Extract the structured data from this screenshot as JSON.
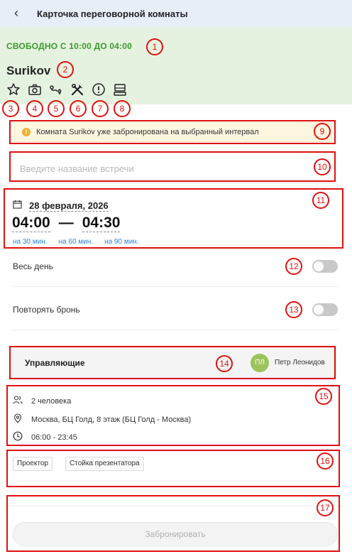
{
  "header": {
    "back_icon": "chevron-left-icon",
    "title": "Карточка переговорной комнаты"
  },
  "room": {
    "status": "СВОБОДНО С 10:00 ДО 04:00",
    "status_color": "#3a9b2a",
    "name": "Surikov",
    "icons": [
      "star-icon",
      "camera-icon",
      "route-icon",
      "tools-icon",
      "alert-icon",
      "workstation-icon"
    ]
  },
  "warning": {
    "text": "Комната Surikov уже забронирована на выбранный интервал"
  },
  "meeting": {
    "placeholder": "Введите название встречи",
    "value": ""
  },
  "schedule": {
    "date": "28 февраля, 2026",
    "start": "04:00",
    "separator": "—",
    "end": "04:30",
    "durations": [
      "на 30 мин.",
      "на 60 мин.",
      "на 90 мин."
    ]
  },
  "options": {
    "all_day_label": "Весь день",
    "all_day": false,
    "repeat_label": "Повторять бронь",
    "repeat": false
  },
  "managers": {
    "label": "Управляющие",
    "avatar_initials": "ПЛ",
    "name": "Петр Леонидов",
    "avatar_color": "#9dc45a"
  },
  "info": {
    "capacity": "2 человека",
    "address": "Москва, БЦ Голд, 8 этаж (БЦ Голд - Москва)",
    "hours": "06:00 - 23:45"
  },
  "equipment": [
    "Проектор",
    "Стойка презентатора"
  ],
  "book_button": {
    "label": "Забронировать",
    "enabled": false
  },
  "badges": [
    "1",
    "2",
    "3",
    "4",
    "5",
    "6",
    "7",
    "8",
    "9",
    "10",
    "11",
    "12",
    "13",
    "14",
    "15",
    "16",
    "17"
  ]
}
